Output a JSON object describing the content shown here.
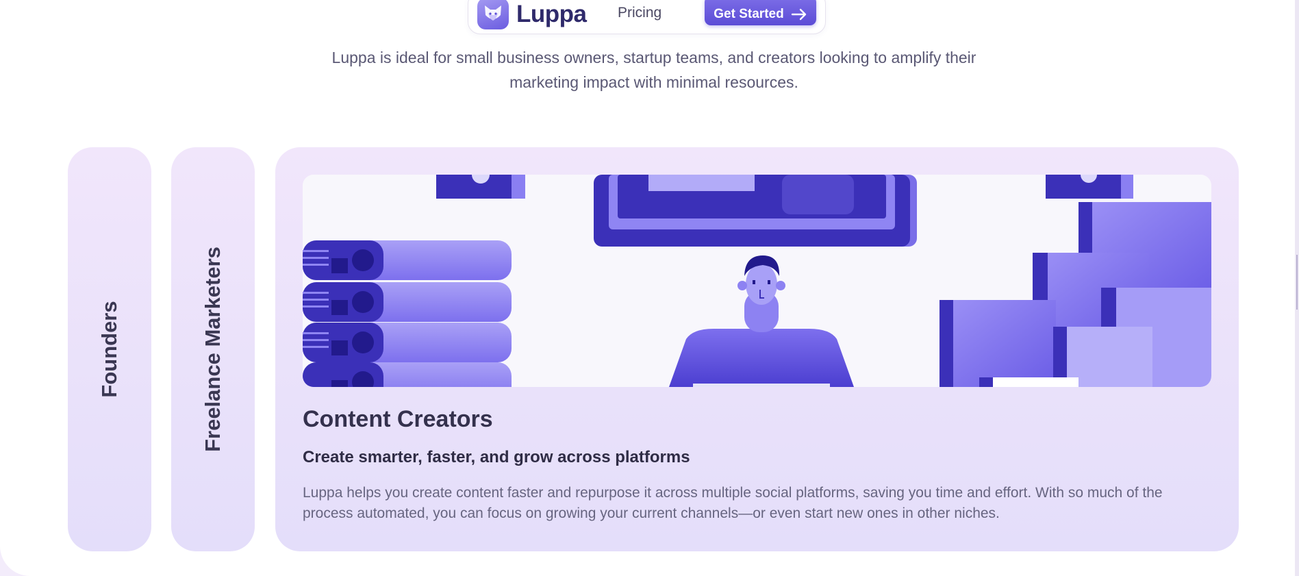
{
  "navbar": {
    "brand": "Luppa",
    "logo_icon": "fox-head-icon",
    "links": [
      {
        "label": "Pricing"
      }
    ],
    "cta": {
      "label": "Get Started",
      "icon": "arrow-right-icon"
    }
  },
  "intro": {
    "text": "Luppa is ideal for small business owners, startup teams, and creators looking to amplify their marketing impact with minimal resources."
  },
  "audience_tabs": [
    {
      "label": "Founders",
      "active": false
    },
    {
      "label": "Freelance Marketers",
      "active": false
    },
    {
      "label": "Content Creators",
      "active": true
    }
  ],
  "active_card": {
    "title": "Content Creators",
    "subtitle": "Create smarter, faster, and grow across platforms",
    "description": "Luppa helps you create content faster and repurpose it across multiple social platforms, saving you time and effort. With so much of the process automated, you can focus on growing your current channels—or even start new ones in other niches.",
    "illustration": "content-creator-illustration"
  },
  "colors": {
    "accent": "#6b5ce0",
    "accent_dark": "#3b30a8",
    "card_bg": "#ece4fb",
    "text_dark": "#34314d",
    "text_muted": "#676580"
  }
}
